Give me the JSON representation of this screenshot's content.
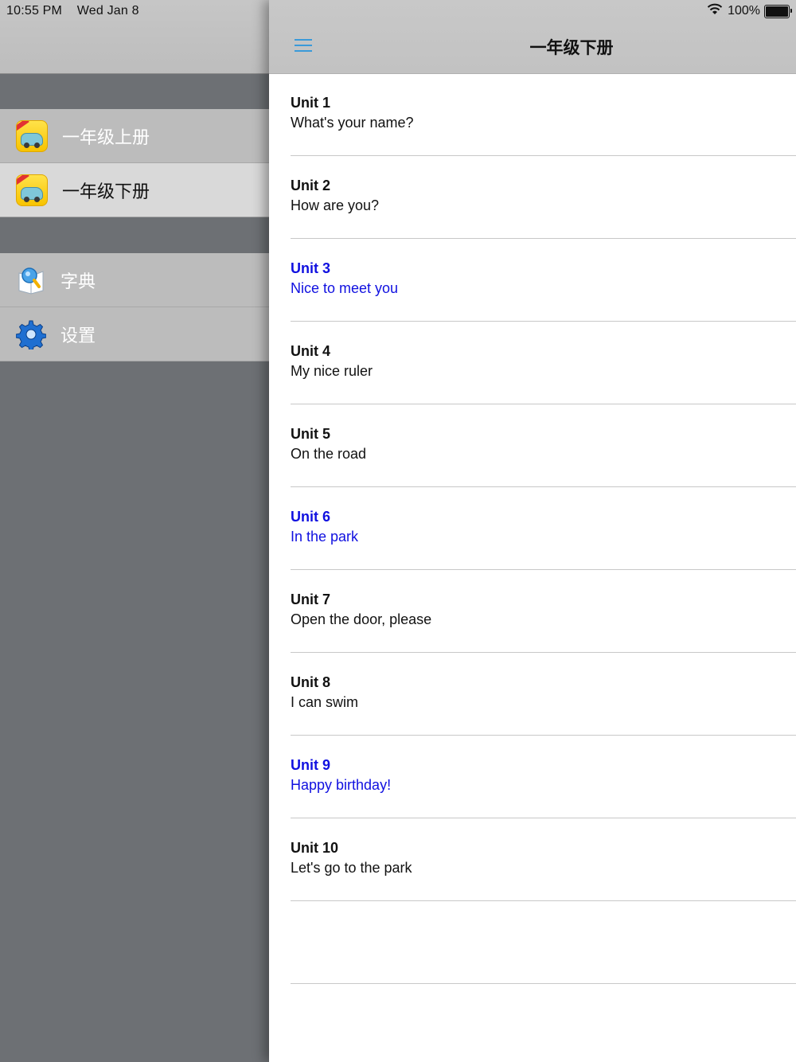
{
  "status_bar": {
    "time": "10:55 PM",
    "date": "Wed Jan 8",
    "battery": "100%"
  },
  "sidebar": {
    "books": [
      {
        "label": "一年级上册",
        "active": false
      },
      {
        "label": "一年级下册",
        "active": true
      }
    ],
    "tools": [
      {
        "label": "字典",
        "icon": "dictionary-icon"
      },
      {
        "label": "设置",
        "icon": "gear-icon"
      }
    ]
  },
  "header": {
    "title": "一年级下册",
    "menu_icon": "hamburger-menu-icon"
  },
  "colors": {
    "highlight_text": "#1010e0",
    "accent": "#3a9ad9"
  },
  "units": [
    {
      "number": "Unit 1",
      "title": "What's your name?",
      "highlighted": false
    },
    {
      "number": "Unit 2",
      "title": "How are you?",
      "highlighted": false
    },
    {
      "number": "Unit 3",
      "title": "Nice to meet you",
      "highlighted": true
    },
    {
      "number": "Unit 4",
      "title": "My nice ruler",
      "highlighted": false
    },
    {
      "number": "Unit 5",
      "title": "On the road",
      "highlighted": false
    },
    {
      "number": "Unit 6",
      "title": "In the park",
      "highlighted": true
    },
    {
      "number": "Unit 7",
      "title": "Open the door, please",
      "highlighted": false
    },
    {
      "number": "Unit 8",
      "title": "I can swim",
      "highlighted": false
    },
    {
      "number": "Unit 9",
      "title": "Happy birthday!",
      "highlighted": true
    },
    {
      "number": "Unit 10",
      "title": "Let's go to the park",
      "highlighted": false
    }
  ]
}
